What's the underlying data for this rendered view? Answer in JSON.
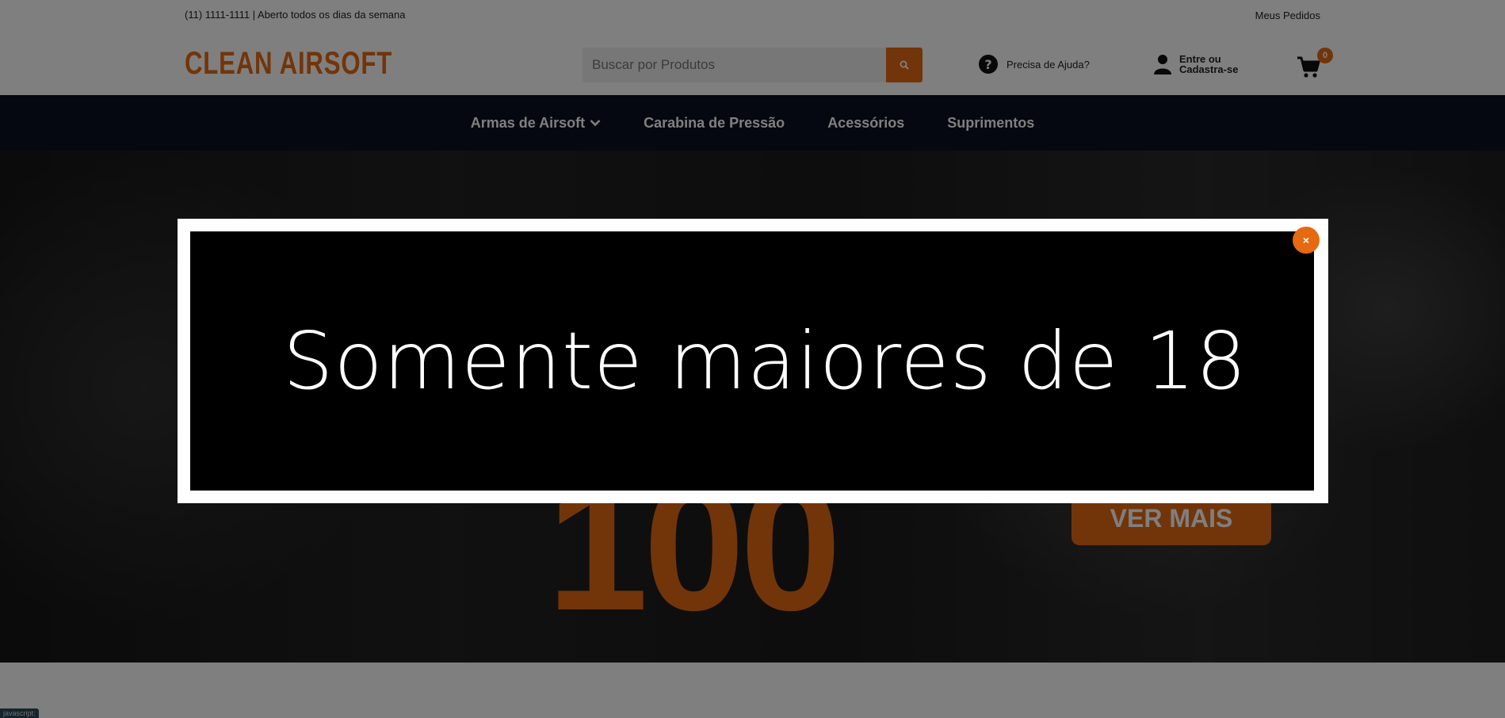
{
  "topbar": {
    "contact": "(11) 1111-1111 | Aberto todos os dias da semana",
    "orders_link": "Meus Pedidos"
  },
  "header": {
    "logo": "CLEAN AIRSOFT",
    "search_placeholder": "Buscar por Produtos",
    "help_label": "Precisa de Ajuda?",
    "account_label_line1": "Entre ou",
    "account_label_line2": "Cadastra-se",
    "cart_count": "0"
  },
  "nav": {
    "items": [
      {
        "label": "Armas de Airsoft",
        "has_dropdown": true
      },
      {
        "label": "Carabina de Pressão"
      },
      {
        "label": "Acessórios"
      },
      {
        "label": "Suprimentos"
      }
    ]
  },
  "banner": {
    "big_number": "100",
    "cta_label": "VER MAIS"
  },
  "modal": {
    "headline": "Somente maiores de 18",
    "close_label": "×"
  },
  "debug": {
    "status_text": "javascript:"
  },
  "colors": {
    "accent": "#e56a12",
    "nav_bg": "#0b1021",
    "overlay": "rgba(0,0,0,0.5)"
  }
}
